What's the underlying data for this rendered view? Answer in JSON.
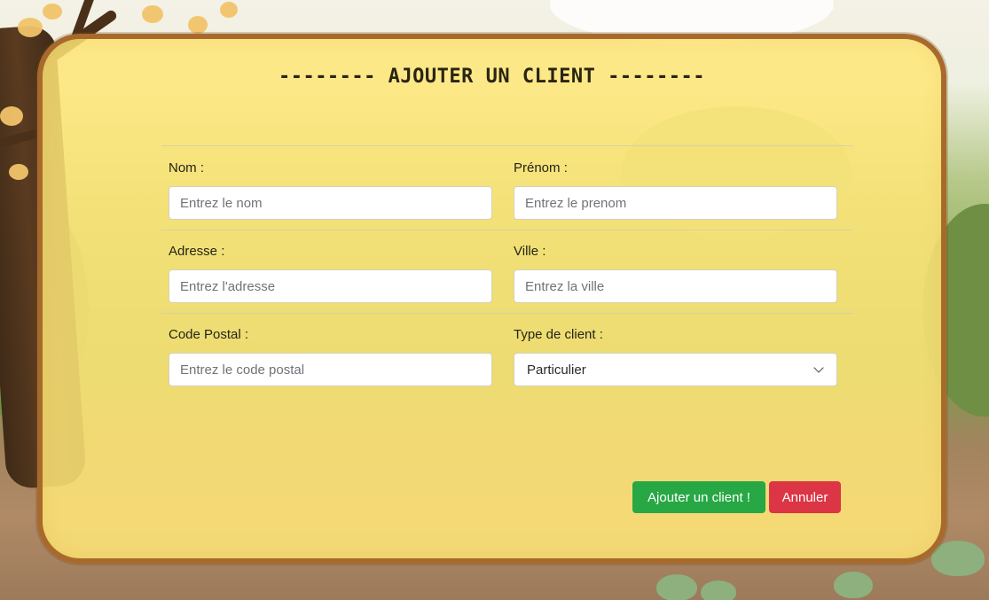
{
  "form": {
    "title": "-------- AJOUTER UN CLIENT --------",
    "fields": {
      "nom": {
        "label": "Nom :",
        "placeholder": "Entrez le nom",
        "value": ""
      },
      "prenom": {
        "label": "Prénom :",
        "placeholder": "Entrez le prenom",
        "value": ""
      },
      "adresse": {
        "label": "Adresse :",
        "placeholder": "Entrez l'adresse",
        "value": ""
      },
      "ville": {
        "label": "Ville :",
        "placeholder": "Entrez la ville",
        "value": ""
      },
      "code_postal": {
        "label": "Code Postal :",
        "placeholder": "Entrez le code postal",
        "value": ""
      },
      "type_client": {
        "label": "Type de client :",
        "selected": "Particulier"
      }
    },
    "buttons": {
      "submit_label": "Ajouter un client !",
      "cancel_label": "Annuler"
    }
  },
  "icons": {
    "select_arrow": "chevron-down-icon"
  },
  "colors": {
    "card_background": "#ffe678",
    "card_border": "#a86a2c",
    "submit_button": "#28a745",
    "cancel_button": "#dc3545"
  }
}
